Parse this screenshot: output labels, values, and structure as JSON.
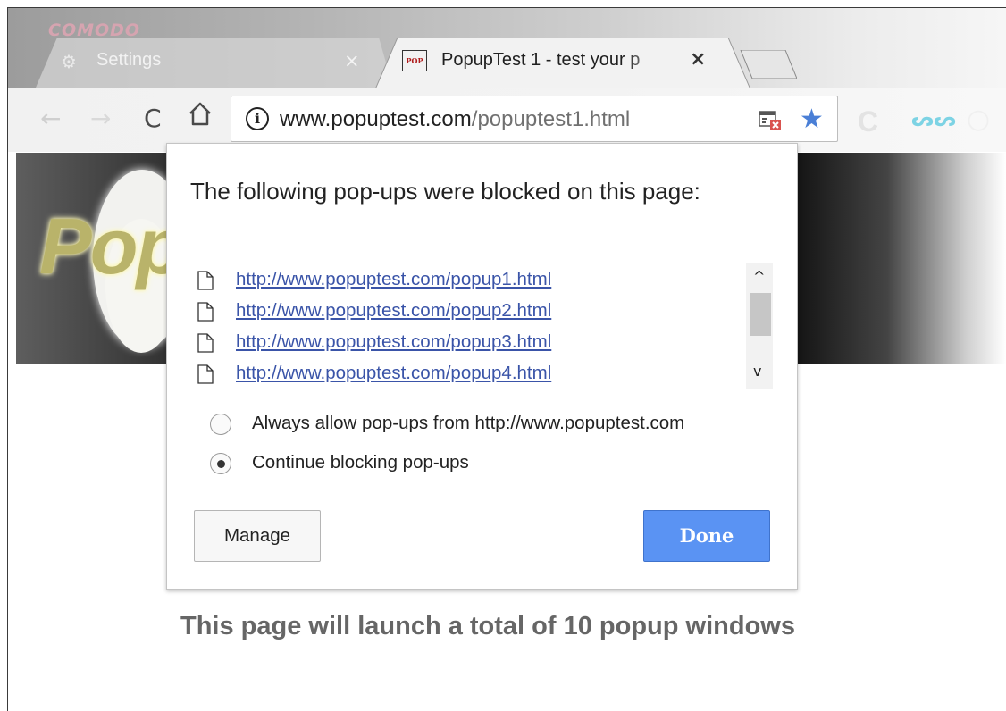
{
  "brand": "COMODO",
  "tabs": [
    {
      "label": "Settings",
      "icon": "gear-icon",
      "active": false,
      "close": "×"
    },
    {
      "label": "PopupTest 1 - test your p",
      "icon": "popuptest-favicon",
      "favicon_text": "POP",
      "active": true,
      "close": "×"
    }
  ],
  "toolbar": {
    "back": "←",
    "forward": "→",
    "reload": "C",
    "info_glyph": "i",
    "url_host": "www.popuptest.com",
    "url_path": "/popuptest1.html",
    "star": "★",
    "ext1": "C",
    "ext2": "ᔕᔕ",
    "ext3": "○"
  },
  "popup_bubble": {
    "title": "The following pop-ups were blocked on this page:",
    "blocked_popups": [
      "http://www.popuptest.com/popup1.html",
      "http://www.popuptest.com/popup2.html",
      "http://www.popuptest.com/popup3.html",
      "http://www.popuptest.com/popup4.html"
    ],
    "scroll_up": "^",
    "scroll_down": "v",
    "options": [
      {
        "label": "Always allow pop-ups from http://www.popuptest.com",
        "checked": false
      },
      {
        "label": "Continue blocking pop-ups",
        "checked": true
      }
    ],
    "manage_label": "Manage",
    "done_label": "Done"
  },
  "page": {
    "logo_text": "Pop",
    "message": "This page will launch a total of 10 popup windows"
  },
  "colors": {
    "link": "#3a54a8",
    "done_button": "#5a93f3",
    "star": "#4a7fd6",
    "brand": "#d6a4b0"
  }
}
